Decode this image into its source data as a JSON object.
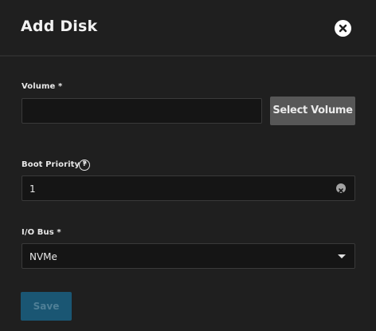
{
  "dialog": {
    "title": "Add Disk",
    "close_icon": "close-icon"
  },
  "volume": {
    "label": "Volume *",
    "value": "",
    "select_button": "Select Volume"
  },
  "boot_priority": {
    "label": "Boot Priority *",
    "help_icon": "help-icon",
    "help_glyph": "?",
    "value": "1",
    "clear_icon": "clear-icon"
  },
  "io_bus": {
    "label": "I/O Bus *",
    "value": "NVMe",
    "dropdown_icon": "caret-down-icon"
  },
  "actions": {
    "save_label": "Save",
    "save_enabled": false
  },
  "colors": {
    "background": "#1f1f1f",
    "field_background": "#151515",
    "select_button": "#575757",
    "save_button_disabled": "#1a5673"
  }
}
